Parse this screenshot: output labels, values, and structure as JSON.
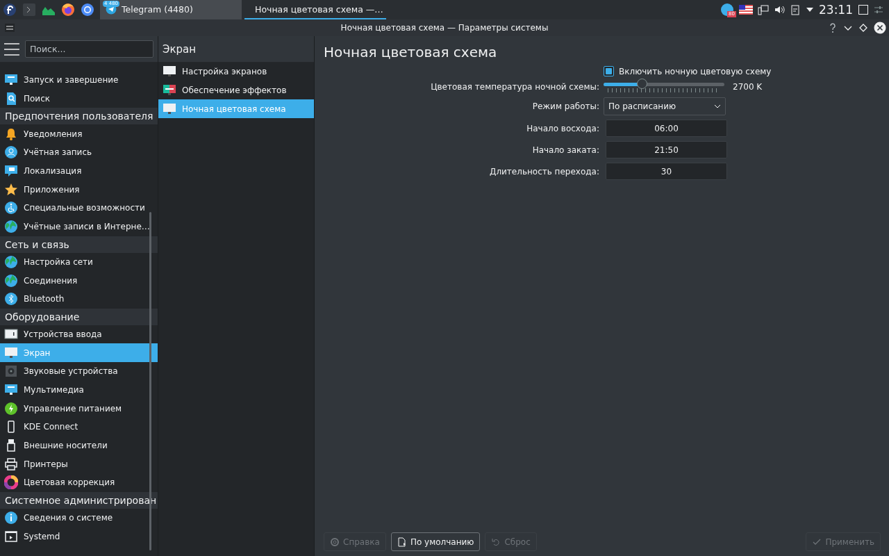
{
  "taskbar": {
    "tasks": [
      {
        "title": "Telegram (4480)",
        "badge": "4 480",
        "selected": false
      },
      {
        "title": "Ночная цветовая схема  —…",
        "selected": true
      }
    ],
    "tray_badge": "80",
    "clock": "23:11"
  },
  "window": {
    "title": "Ночная цветовая схема — Параметры системы"
  },
  "sidebar": {
    "search_placeholder": "Поиск...",
    "items": [
      {
        "kind": "item",
        "label": "Запуск и завершение",
        "selected": false
      },
      {
        "kind": "item",
        "label": "Поиск",
        "selected": false
      },
      {
        "kind": "category",
        "label": "Предпочтения пользователя"
      },
      {
        "kind": "item",
        "label": "Уведомления",
        "selected": false
      },
      {
        "kind": "item",
        "label": "Учётная запись",
        "selected": false
      },
      {
        "kind": "item",
        "label": "Локализация",
        "selected": false
      },
      {
        "kind": "item",
        "label": "Приложения",
        "selected": false
      },
      {
        "kind": "item",
        "label": "Специальные возможности",
        "selected": false
      },
      {
        "kind": "item",
        "label": "Учётные записи в Интерне…",
        "selected": false
      },
      {
        "kind": "category",
        "label": "Сеть и связь"
      },
      {
        "kind": "item",
        "label": "Настройка сети",
        "selected": false
      },
      {
        "kind": "item",
        "label": "Соединения",
        "selected": false
      },
      {
        "kind": "item",
        "label": "Bluetooth",
        "selected": false
      },
      {
        "kind": "category",
        "label": "Оборудование"
      },
      {
        "kind": "item",
        "label": "Устройства ввода",
        "selected": false
      },
      {
        "kind": "item",
        "label": "Экран",
        "selected": true
      },
      {
        "kind": "item",
        "label": "Звуковые устройства",
        "selected": false
      },
      {
        "kind": "item",
        "label": "Мультимедиа",
        "selected": false
      },
      {
        "kind": "item",
        "label": "Управление питанием",
        "selected": false
      },
      {
        "kind": "item",
        "label": "KDE Connect",
        "selected": false
      },
      {
        "kind": "item",
        "label": "Внешние носители",
        "selected": false
      },
      {
        "kind": "item",
        "label": "Принтеры",
        "selected": false
      },
      {
        "kind": "item",
        "label": "Цветовая коррекция",
        "selected": false
      },
      {
        "kind": "category",
        "label": "Системное администрирован"
      },
      {
        "kind": "item",
        "label": "Сведения о системе",
        "selected": false
      },
      {
        "kind": "item",
        "label": "Systemd",
        "selected": false
      }
    ]
  },
  "subpages": {
    "title": "Экран",
    "items": [
      {
        "label": "Настройка экранов",
        "selected": false
      },
      {
        "label": "Обеспечение эффектов",
        "selected": false
      },
      {
        "label": "Ночная цветовая схема",
        "selected": true
      }
    ]
  },
  "page": {
    "title": "Ночная цветовая схема",
    "enable": {
      "label": "Включить ночную цветовую схему",
      "checked": true
    },
    "temperature": {
      "label": "Цветовая температура ночной схемы:",
      "level": 0.32,
      "reading": "2700 K"
    },
    "mode": {
      "label": "Режим работы:",
      "value": "По расписанию"
    },
    "fields": [
      {
        "label": "Начало восхода:",
        "value": "06:00"
      },
      {
        "label": "Начало заката:",
        "value": "21:50"
      },
      {
        "label": "Длительность перехода:",
        "value": "30"
      }
    ]
  },
  "buttons": [
    {
      "kind": "help",
      "label": "Справка",
      "disabled": true
    },
    {
      "kind": "defaults",
      "label": "По умолчанию",
      "disabled": false
    },
    {
      "kind": "reset",
      "label": "Сброс",
      "disabled": true
    },
    {
      "kind": "apply",
      "label": "Применить",
      "disabled": true
    }
  ]
}
